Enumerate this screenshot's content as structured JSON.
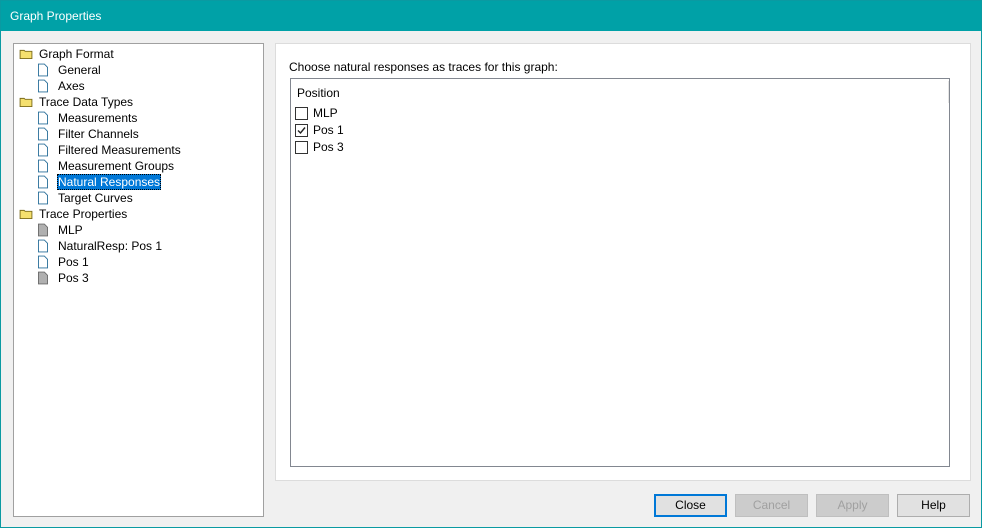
{
  "window": {
    "title": "Graph Properties"
  },
  "tree": {
    "graph_format": {
      "label": "Graph Format",
      "children": [
        "General",
        "Axes"
      ]
    },
    "trace_data_types": {
      "label": "Trace Data Types",
      "children": [
        "Measurements",
        "Filter Channels",
        "Filtered Measurements",
        "Measurement Groups",
        "Natural Responses",
        "Target Curves"
      ],
      "selected": "Natural Responses"
    },
    "trace_properties": {
      "label": "Trace Properties",
      "children": [
        "MLP",
        "NaturalResp: Pos 1",
        "Pos 1",
        "Pos 3"
      ]
    }
  },
  "panel": {
    "prompt": "Choose natural responses as traces for this graph:",
    "column_header": "Position",
    "items": [
      {
        "label": "MLP",
        "checked": false
      },
      {
        "label": "Pos 1",
        "checked": true
      },
      {
        "label": "Pos 3",
        "checked": false
      }
    ]
  },
  "buttons": {
    "close": "Close",
    "cancel": "Cancel",
    "apply": "Apply",
    "help": "Help"
  },
  "colors": {
    "titlebar": "#00a1a7",
    "selection": "#0078d7",
    "folder": "#f5e06e"
  },
  "icons": {
    "folder": "folder-icon",
    "page": "page-icon",
    "page_gray": "gray-page-icon"
  }
}
